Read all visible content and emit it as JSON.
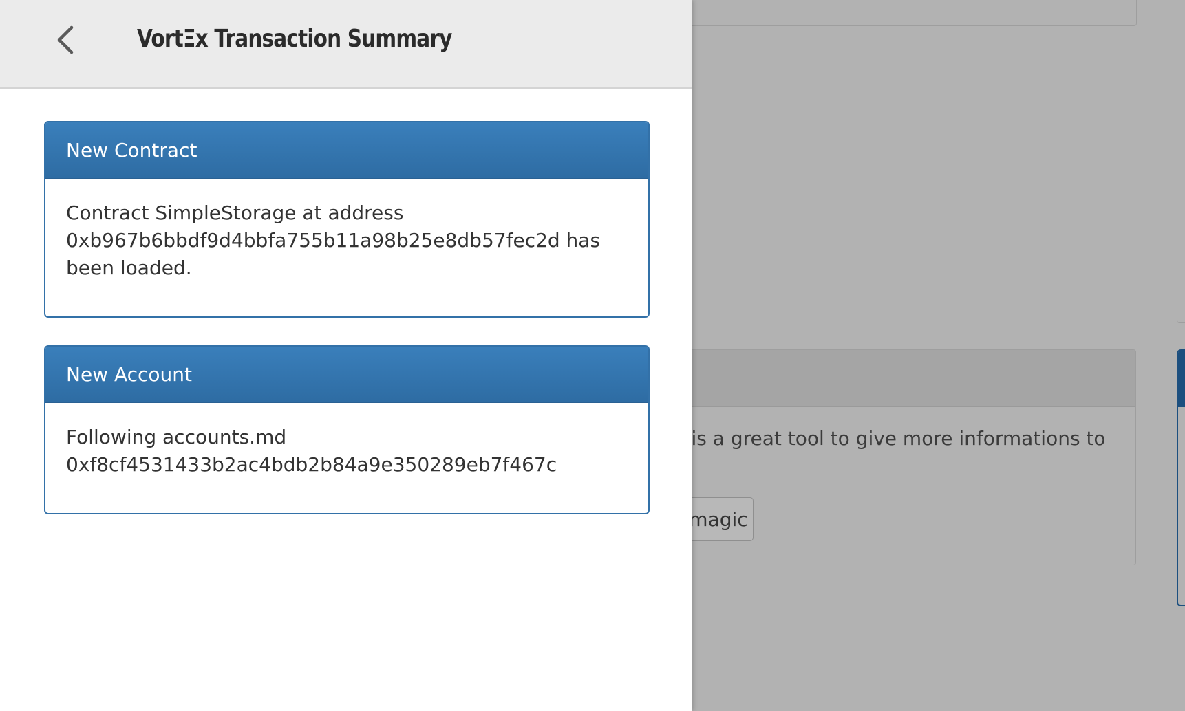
{
  "drawer": {
    "title": "VortΞx Transaction Summary",
    "back_icon": "chevron-left-icon"
  },
  "cards": [
    {
      "heading": "New Contract",
      "body": "Contract SimpleStorage at address 0xb967b6bbdf9d4bbfa755b11a98b25e8db57fec2d has been loaded."
    },
    {
      "heading": "New Account",
      "body_line1": "Following accounts.md",
      "body_line2": "0xf8cf4531433b2ac4bdb2b84a9e350289eb7f467c"
    }
  ],
  "background": {
    "panel_text": "s is a great tool to give more informations to",
    "button_label": "magic"
  },
  "colors": {
    "card_heading": "#3371a8",
    "overlay": "#b2b2b2",
    "drawer_header": "#ebebeb"
  }
}
